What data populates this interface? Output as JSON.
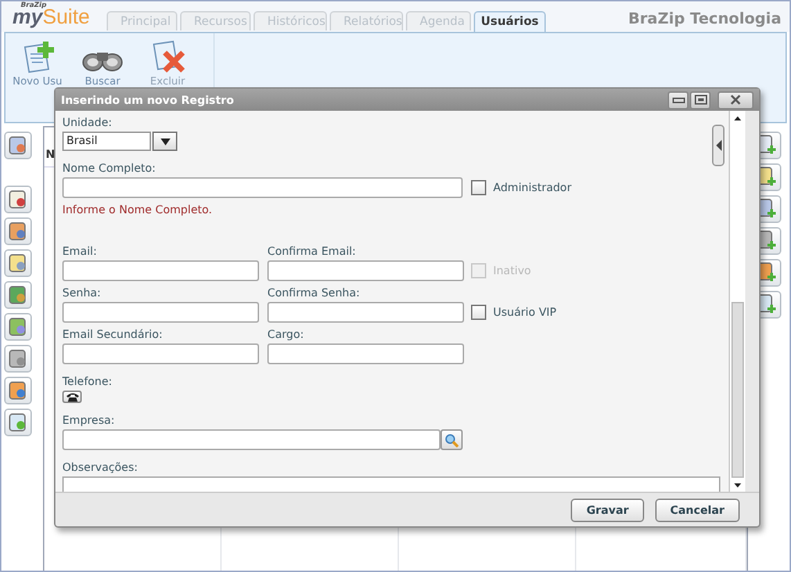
{
  "app": {
    "logo_small": "BraZip",
    "logo_my": "my",
    "logo_suite": "Suite",
    "company": "BraZip Tecnologia"
  },
  "tabs": [
    {
      "label": "Principal",
      "selected": false
    },
    {
      "label": "Recursos",
      "selected": false
    },
    {
      "label": "Históricos",
      "selected": false
    },
    {
      "label": "Relatórios",
      "selected": false
    },
    {
      "label": "Agenda",
      "selected": false
    },
    {
      "label": "Usuários",
      "selected": true
    }
  ],
  "ribbon": [
    {
      "label": "Novo Usu",
      "kind": "new",
      "disabled": false
    },
    {
      "label": "Buscar",
      "kind": "search",
      "disabled": false
    },
    {
      "label": "Excluir",
      "kind": "delete",
      "disabled": true
    }
  ],
  "grid": {
    "column_1": "N"
  },
  "dialog": {
    "title": "Inserindo um novo Registro",
    "unidade": {
      "label": "Unidade:",
      "value": "Brasil"
    },
    "nome": {
      "label": "Nome Completo:",
      "error": "Informe o Nome Completo."
    },
    "administrador": {
      "label": "Administrador",
      "checked": false,
      "disabled": false
    },
    "email": {
      "label": "Email:"
    },
    "confirma_email": {
      "label": "Confirma Email:"
    },
    "inativo": {
      "label": "Inativo",
      "checked": false,
      "disabled": true
    },
    "senha": {
      "label": "Senha:"
    },
    "confirma_senha": {
      "label": "Confirma Senha:"
    },
    "vip": {
      "label": "Usuário VIP",
      "checked": false,
      "disabled": false
    },
    "email_secundario": {
      "label": "Email Secundário:"
    },
    "cargo": {
      "label": "Cargo:"
    },
    "telefone": {
      "label": "Telefone:"
    },
    "empresa": {
      "label": "Empresa:"
    },
    "observacoes": {
      "label": "Observações:"
    },
    "buttons": [
      {
        "label": "Gravar"
      },
      {
        "label": "Cancelar"
      }
    ]
  }
}
